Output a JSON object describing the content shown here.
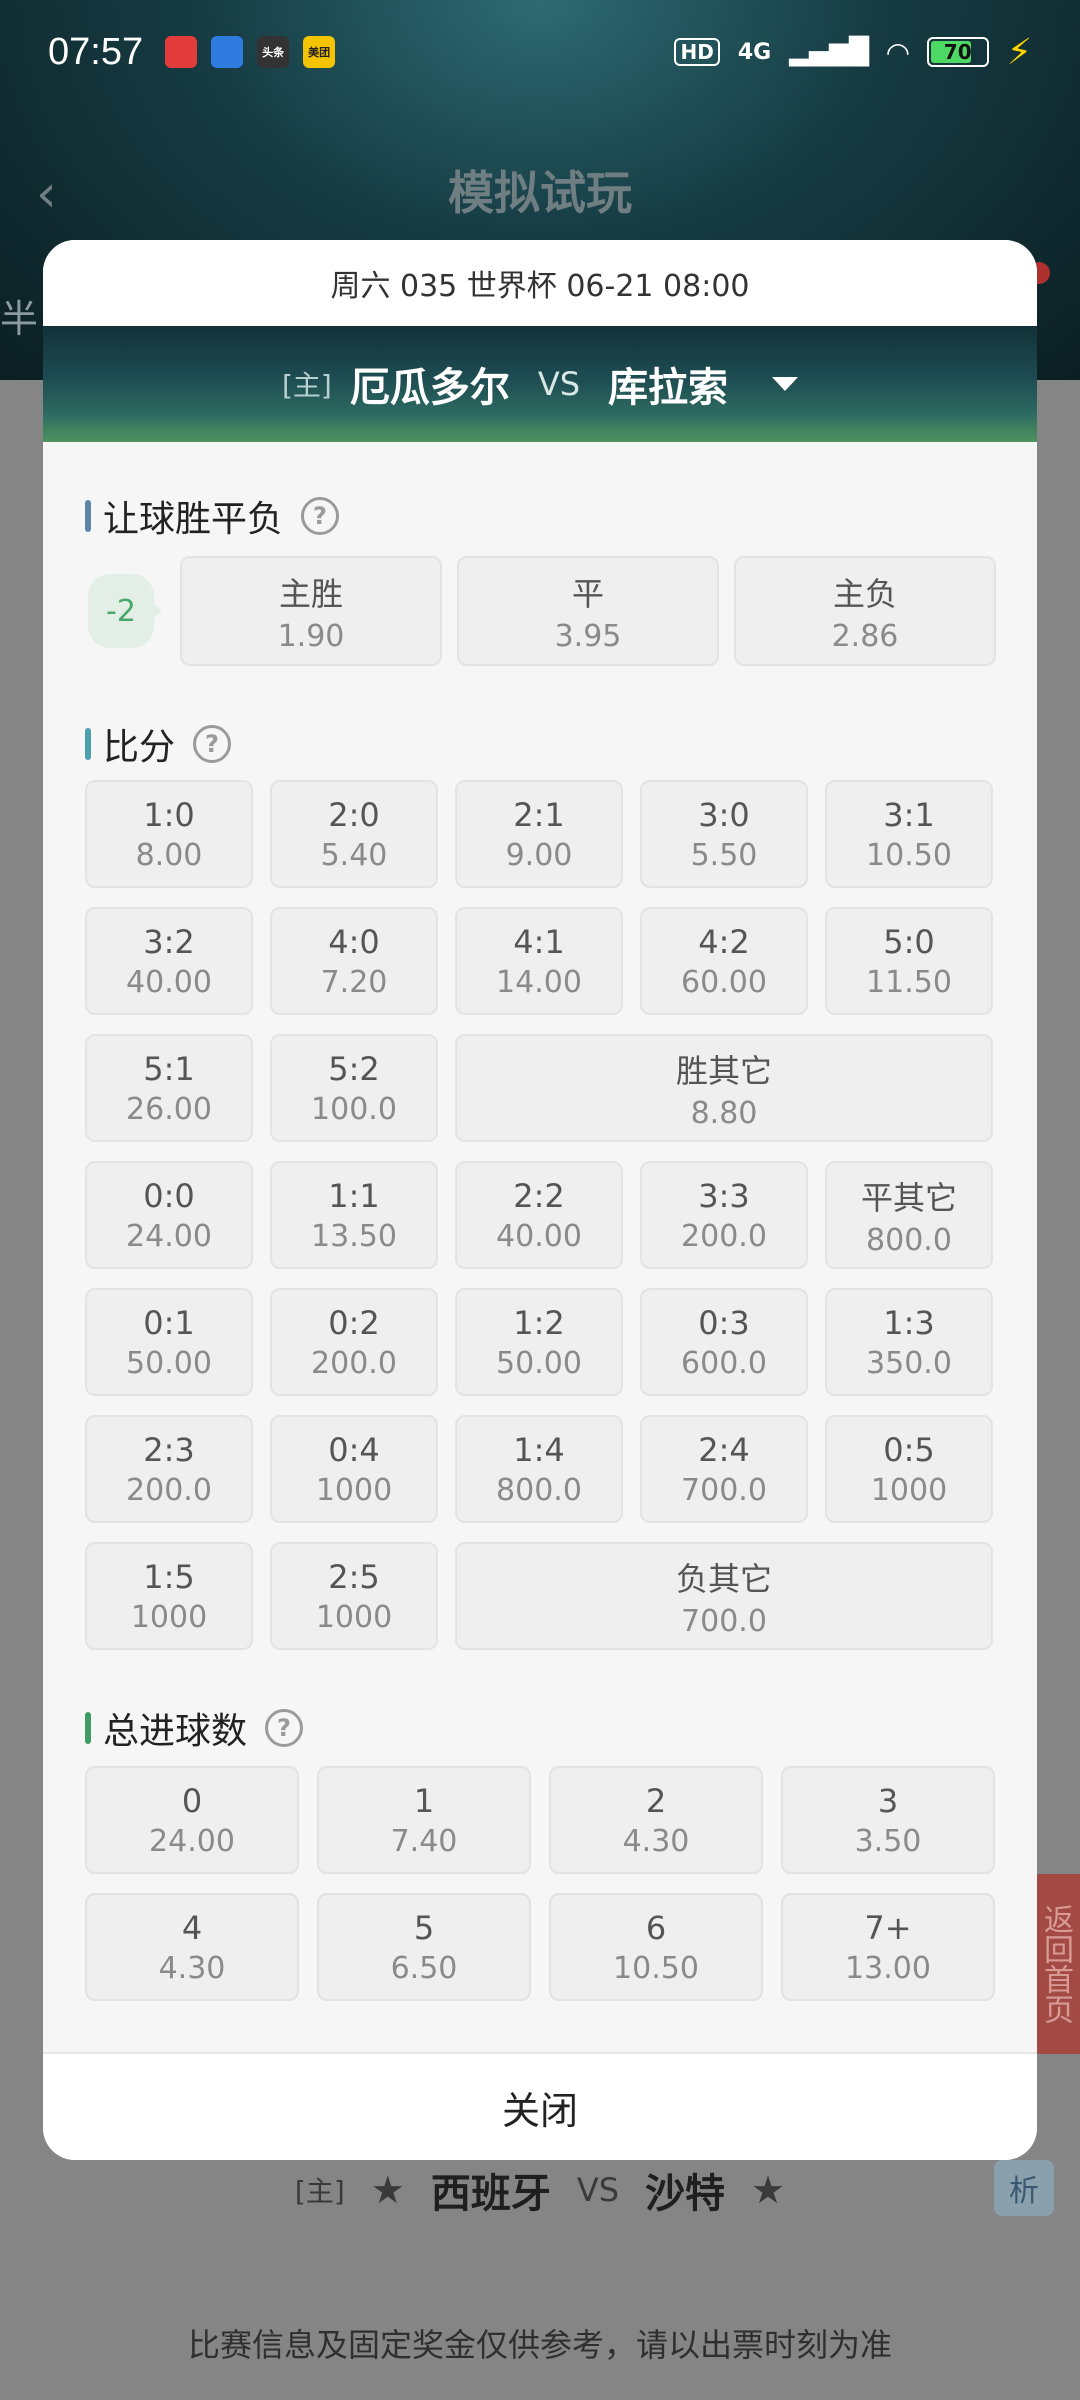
{
  "status_bar": {
    "time": "07:57",
    "apps": [
      {
        "icon": "app-icon-red",
        "color": "#e23b3b",
        "text": ""
      },
      {
        "icon": "app-icon-blue",
        "color": "#2f7be0",
        "text": ""
      },
      {
        "icon": "app-icon-toutiao",
        "color": "#333333",
        "text": "头条"
      },
      {
        "icon": "app-icon-meituan",
        "color": "#f5c400",
        "text": "美团"
      }
    ],
    "hd": "HD",
    "network": "4G",
    "battery": "70"
  },
  "header": {
    "title": "模拟试玩"
  },
  "background": {
    "half_label": "半",
    "match": {
      "home_tag": "[主]",
      "home": "西班牙",
      "vs": "VS",
      "away": "沙特"
    },
    "analyze": "析",
    "note": "比赛信息及固定奖金仅供参考，请以出票时刻为准",
    "side_button": "返回首页"
  },
  "modal": {
    "info": "周六 035 世界杯 06-21 08:00",
    "home_tag": "[主]",
    "home_team": "厄瓜多尔",
    "vs": "VS",
    "away_team": "库拉索",
    "handicap_section": {
      "title": "让球胜平负",
      "handicap": "-2",
      "options": [
        {
          "label": "主胜",
          "odds": "1.90"
        },
        {
          "label": "平",
          "odds": "3.95"
        },
        {
          "label": "主负",
          "odds": "2.86"
        }
      ]
    },
    "score_section": {
      "title": "比分",
      "rows": [
        [
          {
            "label": "1:0",
            "odds": "8.00"
          },
          {
            "label": "2:0",
            "odds": "5.40"
          },
          {
            "label": "2:1",
            "odds": "9.00"
          },
          {
            "label": "3:0",
            "odds": "5.50"
          },
          {
            "label": "3:1",
            "odds": "10.50"
          }
        ],
        [
          {
            "label": "3:2",
            "odds": "40.00"
          },
          {
            "label": "4:0",
            "odds": "7.20"
          },
          {
            "label": "4:1",
            "odds": "14.00"
          },
          {
            "label": "4:2",
            "odds": "60.00"
          },
          {
            "label": "5:0",
            "odds": "11.50"
          }
        ],
        [
          {
            "label": "5:1",
            "odds": "26.00"
          },
          {
            "label": "5:2",
            "odds": "100.0"
          },
          {
            "label": "胜其它",
            "odds": "8.80"
          }
        ],
        [
          {
            "label": "0:0",
            "odds": "24.00"
          },
          {
            "label": "1:1",
            "odds": "13.50"
          },
          {
            "label": "2:2",
            "odds": "40.00"
          },
          {
            "label": "3:3",
            "odds": "200.0"
          },
          {
            "label": "平其它",
            "odds": "800.0"
          }
        ],
        [
          {
            "label": "0:1",
            "odds": "50.00"
          },
          {
            "label": "0:2",
            "odds": "200.0"
          },
          {
            "label": "1:2",
            "odds": "50.00"
          },
          {
            "label": "0:3",
            "odds": "600.0"
          },
          {
            "label": "1:3",
            "odds": "350.0"
          }
        ],
        [
          {
            "label": "2:3",
            "odds": "200.0"
          },
          {
            "label": "0:4",
            "odds": "1000"
          },
          {
            "label": "1:4",
            "odds": "800.0"
          },
          {
            "label": "2:4",
            "odds": "700.0"
          },
          {
            "label": "0:5",
            "odds": "1000"
          }
        ],
        [
          {
            "label": "1:5",
            "odds": "1000"
          },
          {
            "label": "2:5",
            "odds": "1000"
          },
          {
            "label": "负其它",
            "odds": "700.0"
          }
        ]
      ]
    },
    "goals_section": {
      "title": "总进球数",
      "rows": [
        [
          {
            "label": "0",
            "odds": "24.00"
          },
          {
            "label": "1",
            "odds": "7.40"
          },
          {
            "label": "2",
            "odds": "4.30"
          },
          {
            "label": "3",
            "odds": "3.50"
          }
        ],
        [
          {
            "label": "4",
            "odds": "4.30"
          },
          {
            "label": "5",
            "odds": "6.50"
          },
          {
            "label": "6",
            "odds": "10.50"
          },
          {
            "label": "7+",
            "odds": "13.00"
          }
        ]
      ]
    },
    "close": "关闭"
  }
}
